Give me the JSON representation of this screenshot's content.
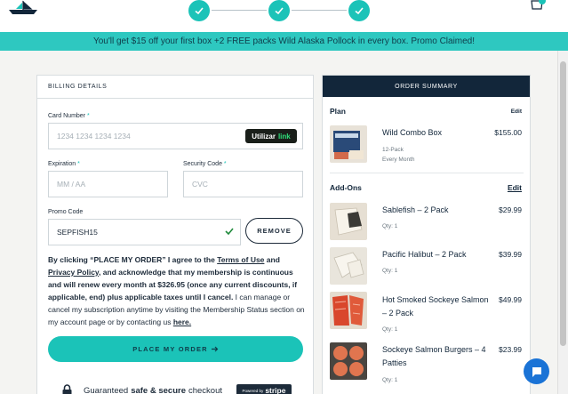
{
  "header": {
    "logo_icon": "boat-logo-icon",
    "steps": [
      {
        "icon": "check-icon"
      },
      {
        "icon": "check-icon"
      },
      {
        "icon": "check-icon"
      }
    ],
    "cart_icon": "cart-icon"
  },
  "promo_banner": {
    "text": "You'll get $15 off your first box +2 FREE packs Wild Alaska Pollock in every box. Promo Claimed!"
  },
  "billing": {
    "title": "BILLING DETAILS",
    "card_number": {
      "label": "Card Number",
      "placeholder": "1234 1234 1234 1234"
    },
    "link_button": {
      "label": "Utilizar",
      "brand": "link"
    },
    "expiration": {
      "label": "Expiration",
      "placeholder": "MM / AA"
    },
    "security_code": {
      "label": "Security Code",
      "placeholder": "CVC"
    },
    "promo_code": {
      "label": "Promo Code",
      "value": "SEPFISH15",
      "status_icon": "check-icon"
    },
    "remove_button": "REMOVE",
    "terms": {
      "p1": "By clicking “PLACE MY ORDER” I agree to the ",
      "terms_link": "Terms of Use",
      "p2": " and ",
      "privacy_link": "Privacy Policy",
      "p3": ", and acknowledge that my membership is continuous and will renew every month at $326.95 (once any current discounts, if applicable, end) plus applicable taxes until I cancel.",
      "p4": " I can manage or cancel my subscription anytime by visiting the Membership Status section on my account page or by contacting us ",
      "here_link": "here."
    },
    "place_order_button": "PLACE MY ORDER",
    "secure": {
      "pre": "Guaranteed",
      "bold": "safe & secure",
      "post": "checkout",
      "powered_by": "Powered by",
      "stripe": "stripe"
    }
  },
  "summary": {
    "title": "ORDER SUMMARY",
    "plan": {
      "heading": "Plan",
      "edit": "Edit",
      "name": "Wild Combo Box",
      "pack": "12-Pack",
      "frequency": "Every Month",
      "price": "$155.00"
    },
    "addons": {
      "heading": "Add-Ons",
      "edit": "Edit",
      "items": [
        {
          "name": "Sablefish – 2 Pack",
          "qty": "Qty: 1",
          "price": "$29.99"
        },
        {
          "name": "Pacific Halibut – 2 Pack",
          "qty": "Qty: 1",
          "price": "$39.99"
        },
        {
          "name": "Hot Smoked Sockeye Salmon – 2 Pack",
          "qty": "Qty: 1",
          "price": "$49.99"
        },
        {
          "name": "Sockeye Salmon Burgers – 4 Patties",
          "qty": "Qty: 1",
          "price": "$23.99"
        }
      ]
    }
  },
  "chat_icon": "chat-bubble-icon",
  "colors": {
    "accent": "#1bc3b8",
    "navy": "#12263a",
    "banner": "#2ec8c0",
    "chat": "#1a73d6"
  }
}
